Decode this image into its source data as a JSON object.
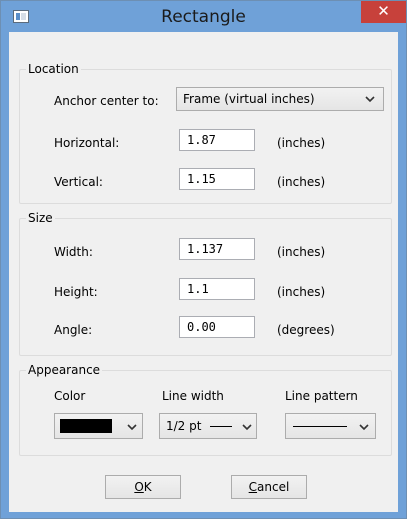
{
  "window": {
    "title": "Rectangle",
    "close_glyph": "✕"
  },
  "location": {
    "title": "Location",
    "anchor_label": "Anchor center to:",
    "anchor_value": "Frame (virtual inches)",
    "horizontal_label": "Horizontal:",
    "horizontal_value": "1.87",
    "horizontal_unit": "(inches)",
    "vertical_label": "Vertical:",
    "vertical_value": "1.15",
    "vertical_unit": "(inches)"
  },
  "size": {
    "title": "Size",
    "width_label": "Width:",
    "width_value": "1.137",
    "width_unit": "(inches)",
    "height_label": "Height:",
    "height_value": "1.1",
    "height_unit": "(inches)",
    "angle_label": "Angle:",
    "angle_value": "0.00",
    "angle_unit": "(degrees)"
  },
  "appearance": {
    "title": "Appearance",
    "color_label": "Color",
    "color_value": "#000000",
    "line_width_label": "Line width",
    "line_width_value": "1/2 pt",
    "line_pattern_label": "Line pattern"
  },
  "buttons": {
    "ok_mnemonic": "O",
    "ok_rest": "K",
    "cancel_mnemonic": "C",
    "cancel_rest": "ancel"
  },
  "colors": {
    "titlebar": "#6fa1d8",
    "close": "#c7413b"
  }
}
